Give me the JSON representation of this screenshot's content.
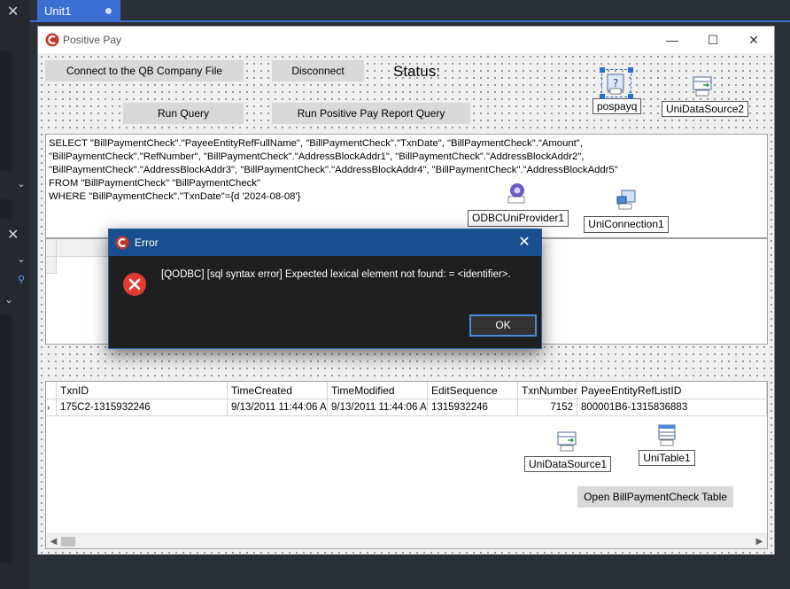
{
  "ide": {
    "tab_label": "Unit1"
  },
  "window": {
    "title": "Positive Pay"
  },
  "buttons": {
    "connect": "Connect to the QB Company File",
    "disconnect": "Disconnect",
    "run_query": "Run Query",
    "run_report": "Run Positive Pay Report Query",
    "open_table": "Open BillPaymentCheck Table"
  },
  "status_label": "Status:",
  "components": {
    "pospayq": "pospayq",
    "unidatasource2": "UniDataSource2",
    "odbcuniprovider1": "ODBCUniProvider1",
    "uniconnection1": "UniConnection1",
    "unidatasource1": "UniDataSource1",
    "unitable1": "UniTable1"
  },
  "sql_lines": [
    "SELECT \"BillPaymentCheck\".\"PayeeEntityRefFullName\", \"BillPaymentCheck\".\"TxnDate\", \"BillPaymentCheck\".\"Amount\",",
    "\"BillPaymentCheck\".\"RefNumber\", \"BillPaymentCheck\".\"AddressBlockAddr1\", \"BillPaymentCheck\".\"AddressBlockAddr2\",",
    "\"BillPaymentCheck\".\"AddressBlockAddr3\", \"BillPaymentCheck\".\"AddressBlockAddr4\", \"BillPaymentCheck\".\"AddressBlockAddr5\"",
    "FROM \"BillPaymentCheck\" \"BillPaymentCheck\"",
    "WHERE \"BillPaymentCheck\".\"TxnDate\"={d '2024-08-08'}"
  ],
  "grid": {
    "columns": [
      "TxnID",
      "TimeCreated",
      "TimeModified",
      "EditSequence",
      "TxnNumber",
      "PayeeEntityRefListID"
    ],
    "rows": [
      [
        "175C2-1315932246",
        "9/13/2011 11:44:06 A",
        "9/13/2011 11:44:06 A",
        "1315932246",
        "7152",
        "800001B6-1315836883"
      ]
    ]
  },
  "dialog": {
    "title": "Error",
    "message": "[QODBC] [sql syntax error] Expected lexical element not found: = <identifier>.",
    "ok_label": "OK"
  }
}
